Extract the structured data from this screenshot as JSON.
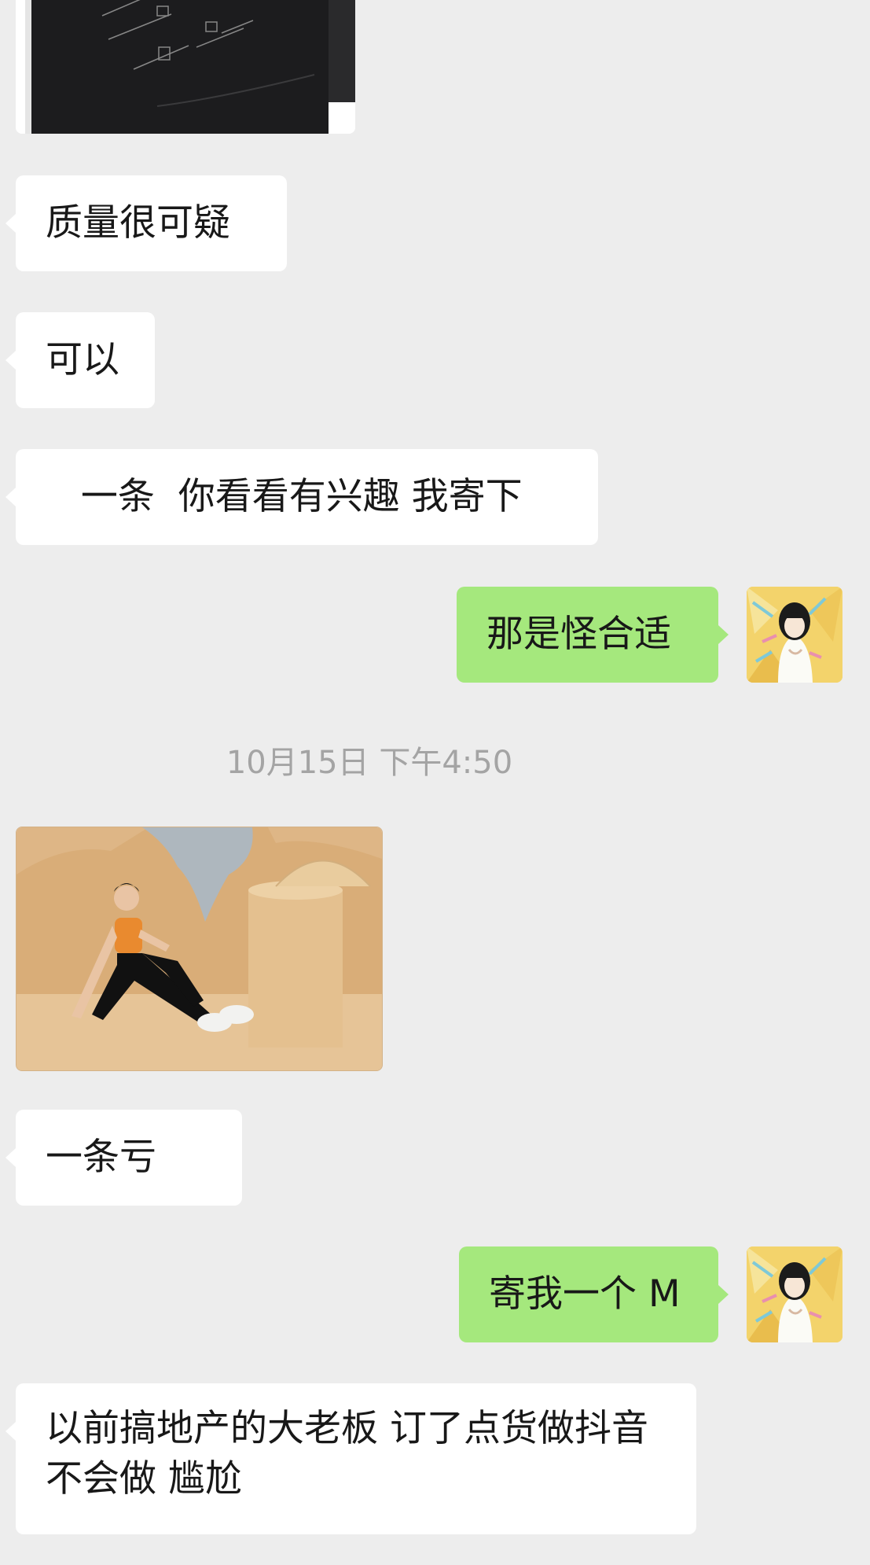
{
  "chat": {
    "messages": [
      {
        "type": "image",
        "side": "left",
        "description": "black garment care label"
      },
      {
        "type": "text",
        "side": "left",
        "text": "质量很可疑"
      },
      {
        "type": "text",
        "side": "left",
        "text": "可以"
      },
      {
        "type": "text",
        "side": "left",
        "text": "   一条  你看看有兴趣 我寄下"
      },
      {
        "type": "text",
        "side": "right",
        "text": "那是怪合适"
      },
      {
        "type": "timestamp",
        "text": "10月15日 下午4:50"
      },
      {
        "type": "image",
        "side": "left",
        "description": "woman in orange top and black leggings sitting on beige set"
      },
      {
        "type": "text",
        "side": "left",
        "text": "一条亏"
      },
      {
        "type": "text",
        "side": "right",
        "text": "寄我一个 M"
      },
      {
        "type": "text",
        "side": "left",
        "text": "以前搞地产的大老板 订了点货做抖音 不会做 尴尬"
      }
    ]
  },
  "colors": {
    "background": "#ededed",
    "incoming_bubble": "#ffffff",
    "outgoing_bubble": "#a5e87d",
    "timestamp_text": "#a4a4a4"
  },
  "icons": {
    "avatar": "user-avatar-illustration"
  }
}
